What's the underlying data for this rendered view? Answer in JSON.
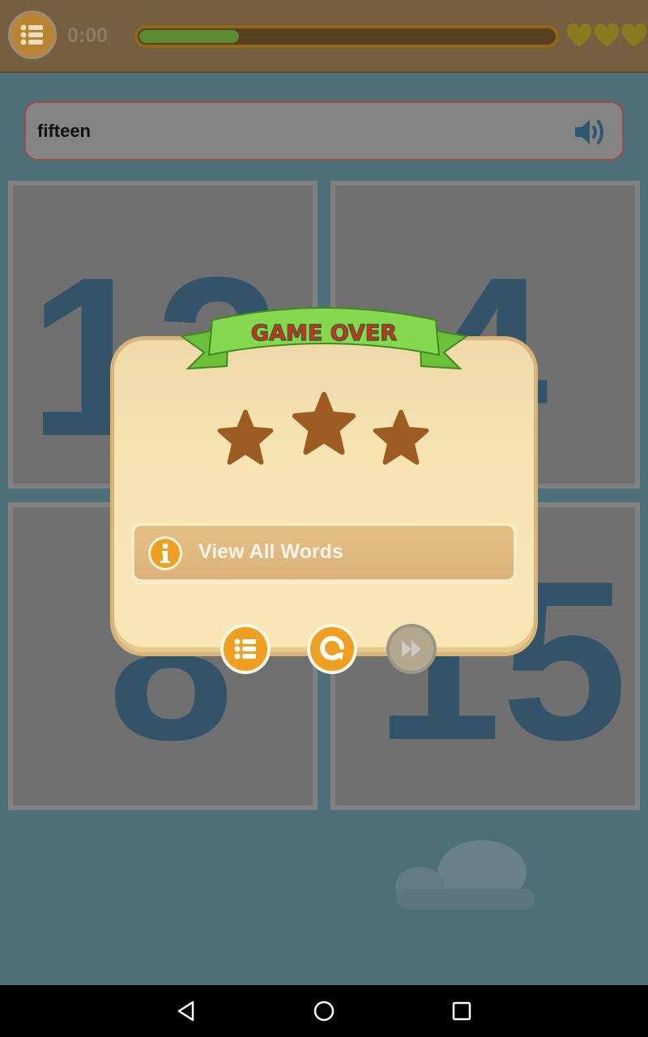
{
  "topbar": {
    "menu_icon": "list-menu-icon",
    "timer": "0:00",
    "progress_fraction": 0.24,
    "lives": 3,
    "life_icon": "heart-icon",
    "colors": {
      "progress_fill": "#5c8a30",
      "heart": "#8b7a1d"
    }
  },
  "prompt": {
    "word": "fifteen",
    "speaker_icon": "speaker-icon"
  },
  "cards": [
    {
      "label": "12"
    },
    {
      "label": "4"
    },
    {
      "label": "8"
    },
    {
      "label": "15"
    }
  ],
  "dialog": {
    "banner_title": "GAME OVER",
    "stars_earned": 0,
    "stars_total": 3,
    "view_all_words_label": "View All Words",
    "buttons": [
      {
        "name": "levels-menu-button",
        "icon": "list-menu-icon",
        "enabled": true
      },
      {
        "name": "replay-button",
        "icon": "replay-icon",
        "enabled": true
      },
      {
        "name": "next-level-button",
        "icon": "fast-forward-icon",
        "enabled": false
      }
    ],
    "colors": {
      "banner_text": "#e8222a",
      "banner_ribbon": "#7dd04a",
      "star_empty": "#9c5c22",
      "button_orange": "#f0a020"
    }
  },
  "navbar": {
    "back_icon": "back-triangle-icon",
    "home_icon": "home-circle-icon",
    "recents_icon": "recents-square-icon"
  }
}
